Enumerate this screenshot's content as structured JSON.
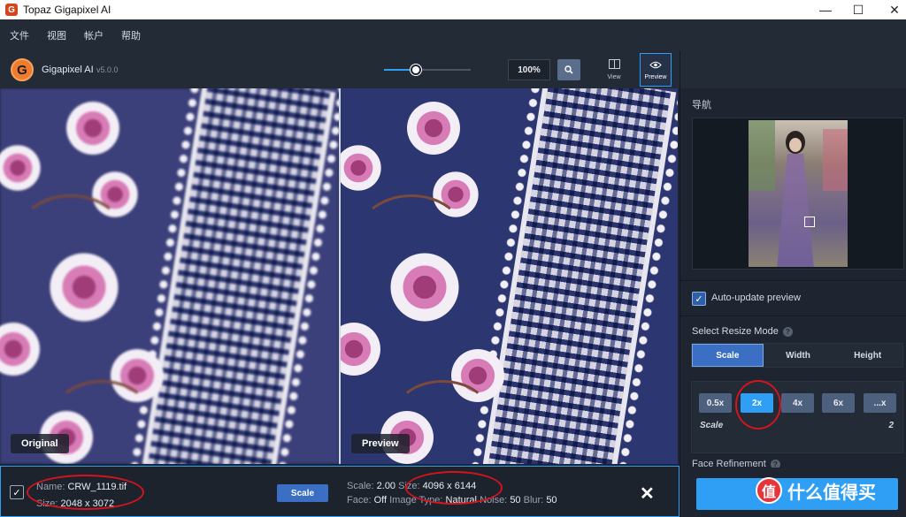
{
  "window": {
    "title": "Topaz Gigapixel AI",
    "app_icon_letter": "G",
    "minimize": "—",
    "maximize": "☐",
    "close": "✕"
  },
  "menu": [
    "文件",
    "视图",
    "帐户",
    "帮助"
  ],
  "toolbar": {
    "logo_letter": "G",
    "brand": "Gigapixel AI",
    "version": "v5.0.0",
    "zoom_value": "100%",
    "zoom_slider_fraction": 0.37,
    "view_label": "View",
    "preview_label": "Preview"
  },
  "panels": {
    "left_label": "Original",
    "right_label": "Preview"
  },
  "bottom": {
    "name_key": "Name:",
    "name_val": "CRW_1119.tif",
    "size_key": "Size:",
    "size_val": "2048 x 3072",
    "scale_button": "Scale",
    "scale_key": "Scale:",
    "scale_val": "2.00",
    "out_size_key": "Size:",
    "out_size_val": "4096 x 6144",
    "face_key": "Face:",
    "face_val": "Off",
    "imgtype_key": "Image Type:",
    "imgtype_val": "Natural",
    "noise_key": "Noise:",
    "noise_val": "50",
    "blur_key": "Blur:",
    "blur_val": "50",
    "close": "✕"
  },
  "right": {
    "nav_title": "导航",
    "auto_update": "Auto-update preview",
    "resize_mode_title": "Select Resize Mode",
    "help": "?",
    "tabs": [
      "Scale",
      "Width",
      "Height"
    ],
    "scale_buttons": [
      "0.5x",
      "2x",
      "4x",
      "6x",
      "...x"
    ],
    "scale_label": "Scale",
    "scale_value": "2",
    "face_refinement": "Face Refinement"
  },
  "watermark": {
    "badge": "值",
    "text": "什么值得买"
  },
  "colors": {
    "accent": "#2f9ff5",
    "annotation": "#d5141d",
    "panel_bg": "#1e2530"
  }
}
